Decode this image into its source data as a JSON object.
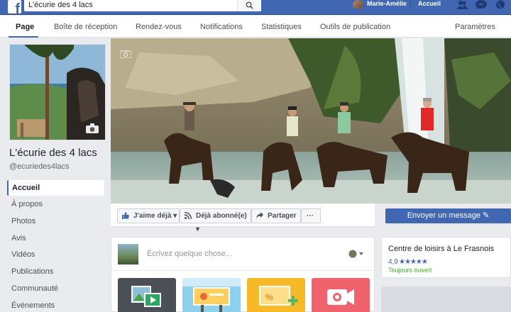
{
  "topbar": {
    "search_value": "L'écurie des 4 lacs",
    "user_name": "Marie-Amélie",
    "home_label": "Accueil"
  },
  "tabs": [
    {
      "label": "Page",
      "active": true
    },
    {
      "label": "Boîte de réception"
    },
    {
      "label": "Rendez-vous"
    },
    {
      "label": "Notifications"
    },
    {
      "label": "Statistiques"
    },
    {
      "label": "Outils de publication"
    },
    {
      "label": "Paramètres"
    }
  ],
  "page": {
    "name": "L'écurie des 4 lacs",
    "handle": "@ecuriedes4lacs"
  },
  "nav": [
    {
      "label": "Accueil",
      "active": true
    },
    {
      "label": "À propos"
    },
    {
      "label": "Photos"
    },
    {
      "label": "Avis"
    },
    {
      "label": "Vidéos"
    },
    {
      "label": "Publications"
    },
    {
      "label": "Communauté"
    },
    {
      "label": "Évènements"
    }
  ],
  "actions": {
    "like": "J'aime déjà",
    "follow": "Déjà abonné(e)",
    "share": "Partager",
    "more": "···",
    "send_message": "Envoyer un message"
  },
  "composer": {
    "placeholder": "Écrivez quelque chose..."
  },
  "info": {
    "title": "Centre de loisirs à Le Frasnois",
    "rating": "4,9",
    "stars": "★★★★★",
    "status": "Toujours ouvert"
  },
  "colors": {
    "brand": "#4267b2",
    "background": "#e9ebee",
    "open_status": "#42b72a"
  }
}
